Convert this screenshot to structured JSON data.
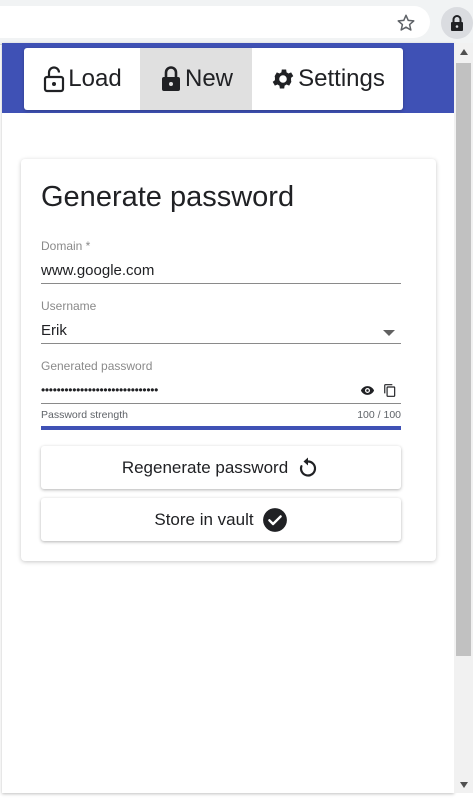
{
  "chrome": {
    "star_icon": "star-outline-icon",
    "extension_icon": "lock-icon"
  },
  "tabs": [
    {
      "label": "Load",
      "icon": "lock-open-icon"
    },
    {
      "label": "New",
      "icon": "lock-icon"
    },
    {
      "label": "Settings",
      "icon": "gear-icon"
    }
  ],
  "form": {
    "title": "Generate password",
    "domain": {
      "label": "Domain *",
      "value": "www.google.com"
    },
    "username": {
      "label": "Username",
      "value": "Erik"
    },
    "password": {
      "label": "Generated password",
      "value": "••••••••••••••••••••••••••••••"
    },
    "strength": {
      "label": "Password strength",
      "value_text": "100 / 100",
      "fraction": 1.0
    }
  },
  "buttons": {
    "regenerate": "Regenerate password",
    "store": "Store in vault"
  },
  "colors": {
    "primary": "#3f51b5",
    "active_tab": "#e0e0e0"
  }
}
